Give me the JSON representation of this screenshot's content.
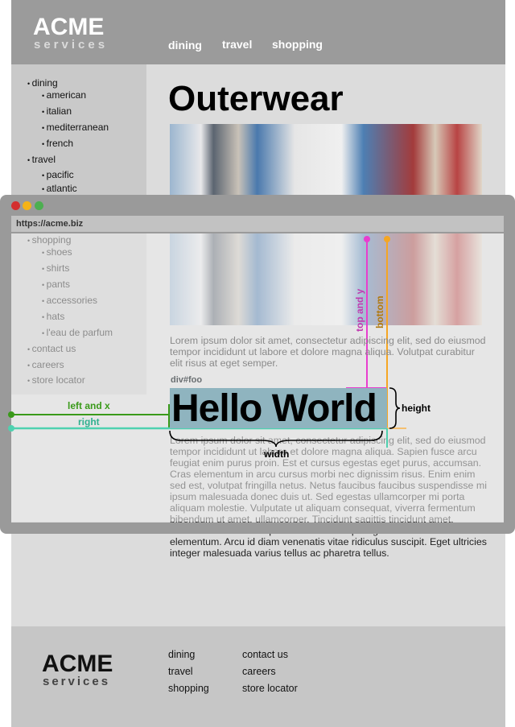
{
  "site": {
    "logo_main": "ACME",
    "logo_sub": "services",
    "nav": [
      "dining",
      "travel",
      "shopping"
    ]
  },
  "sidebar": {
    "items": [
      "dining",
      "american",
      "italian",
      "mediterranean",
      "french",
      "travel",
      "pacific",
      "atlantic",
      "shopping",
      "shoes",
      "shirts",
      "pants",
      "accessories",
      "hats",
      "l'eau de parfum",
      "contact us",
      "careers",
      "store locator"
    ]
  },
  "main": {
    "title": "Outerwear",
    "para1": "Lorem ipsum dolor sit amet, consectetur adipiscing elit, sed do eiusmod tempor incididunt ut labore et dolore magna aliqua. Volutpat curabitur elit risus at eget semper.",
    "element_label": "div#foo",
    "hello": "Hello World",
    "para2": "Lorem ipsum dolor sit amet, consectetur adipiscing elit, sed do eiusmod tempor incididunt ut labore et dolore magna aliqua. Sapien fusce arcu feugiat enim purus proin. Est et cursus egestas eget purus, accumsan. Cras elementum in arcu cursus morbi nec dignissim risus. Enim enim sed est, volutpat fringilla netus. Netus faucibus faucibus suspendisse mi ipsum malesuada donec duis ut. Sed egestas ullamcorper mi porta aliquam molestie. Vulputate ut aliquam consequat, viverra fermentum bibendum ut amet, ullamcorper. Tincidunt sagittis tincidunt amet, elementum. Pellentesque ut eu facilisi turpis egestas ante libero elementum. Arcu id diam venenatis vitae ridiculus suscipit. Eget ultricies integer malesuada varius tellus ac pharetra tellus."
  },
  "footer": {
    "logo_main": "ACME",
    "logo_sub": "services",
    "col1": [
      "dining",
      "travel",
      "shopping"
    ],
    "col2": [
      "contact us",
      "careers",
      "store locator"
    ]
  },
  "browser": {
    "url": "https://acme.biz"
  },
  "annotations": {
    "top": "top and y",
    "bottom": "bottom",
    "left": "left and x",
    "right": "right",
    "height": "height",
    "width": "width",
    "colors": {
      "top": "#e83ecf",
      "bottom": "#f5a623",
      "left": "#3a9a1a",
      "right": "#4fd1b0"
    }
  }
}
